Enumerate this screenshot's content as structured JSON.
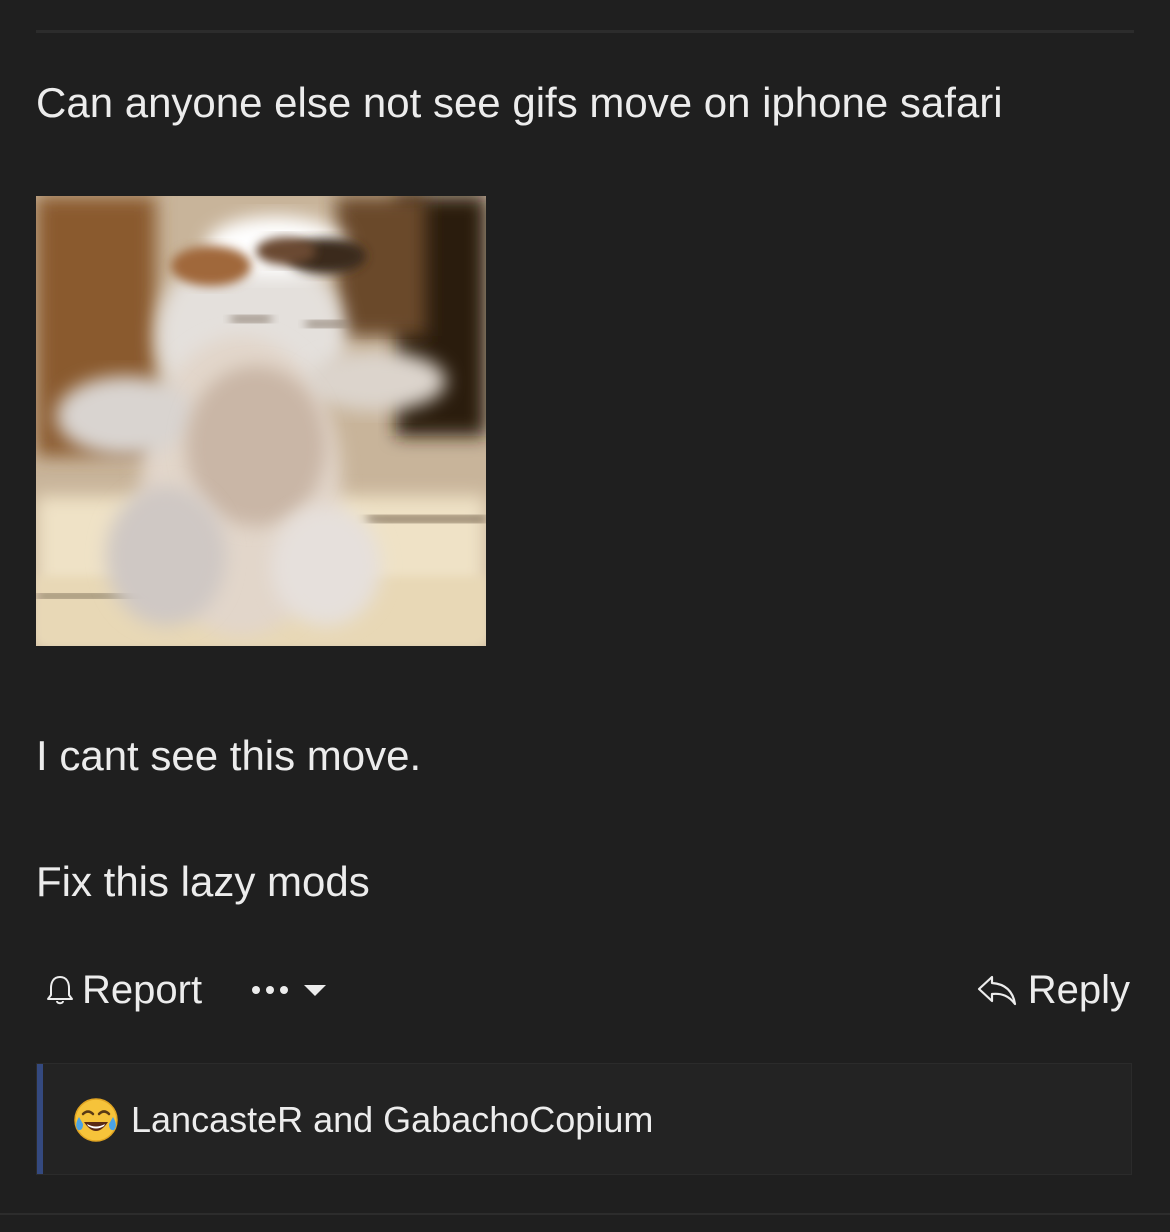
{
  "post": {
    "title_line": "Can anyone else not see gifs move on iphone safari",
    "body_line_1": "I cant see this move.",
    "body_line_2": "Fix this lazy mods"
  },
  "actions": {
    "report_label": "Report",
    "more_icon": "ellipsis-icon",
    "dropdown_icon": "caret-down-icon",
    "reply_label": "Reply"
  },
  "reactions": {
    "emoji_icon": "tears-of-joy-emoji-icon",
    "users": "LancasteR and GabachoCopium",
    "accent_color": "#34497f"
  },
  "colors": {
    "background": "#1f1f1f",
    "text": "#ececec"
  }
}
